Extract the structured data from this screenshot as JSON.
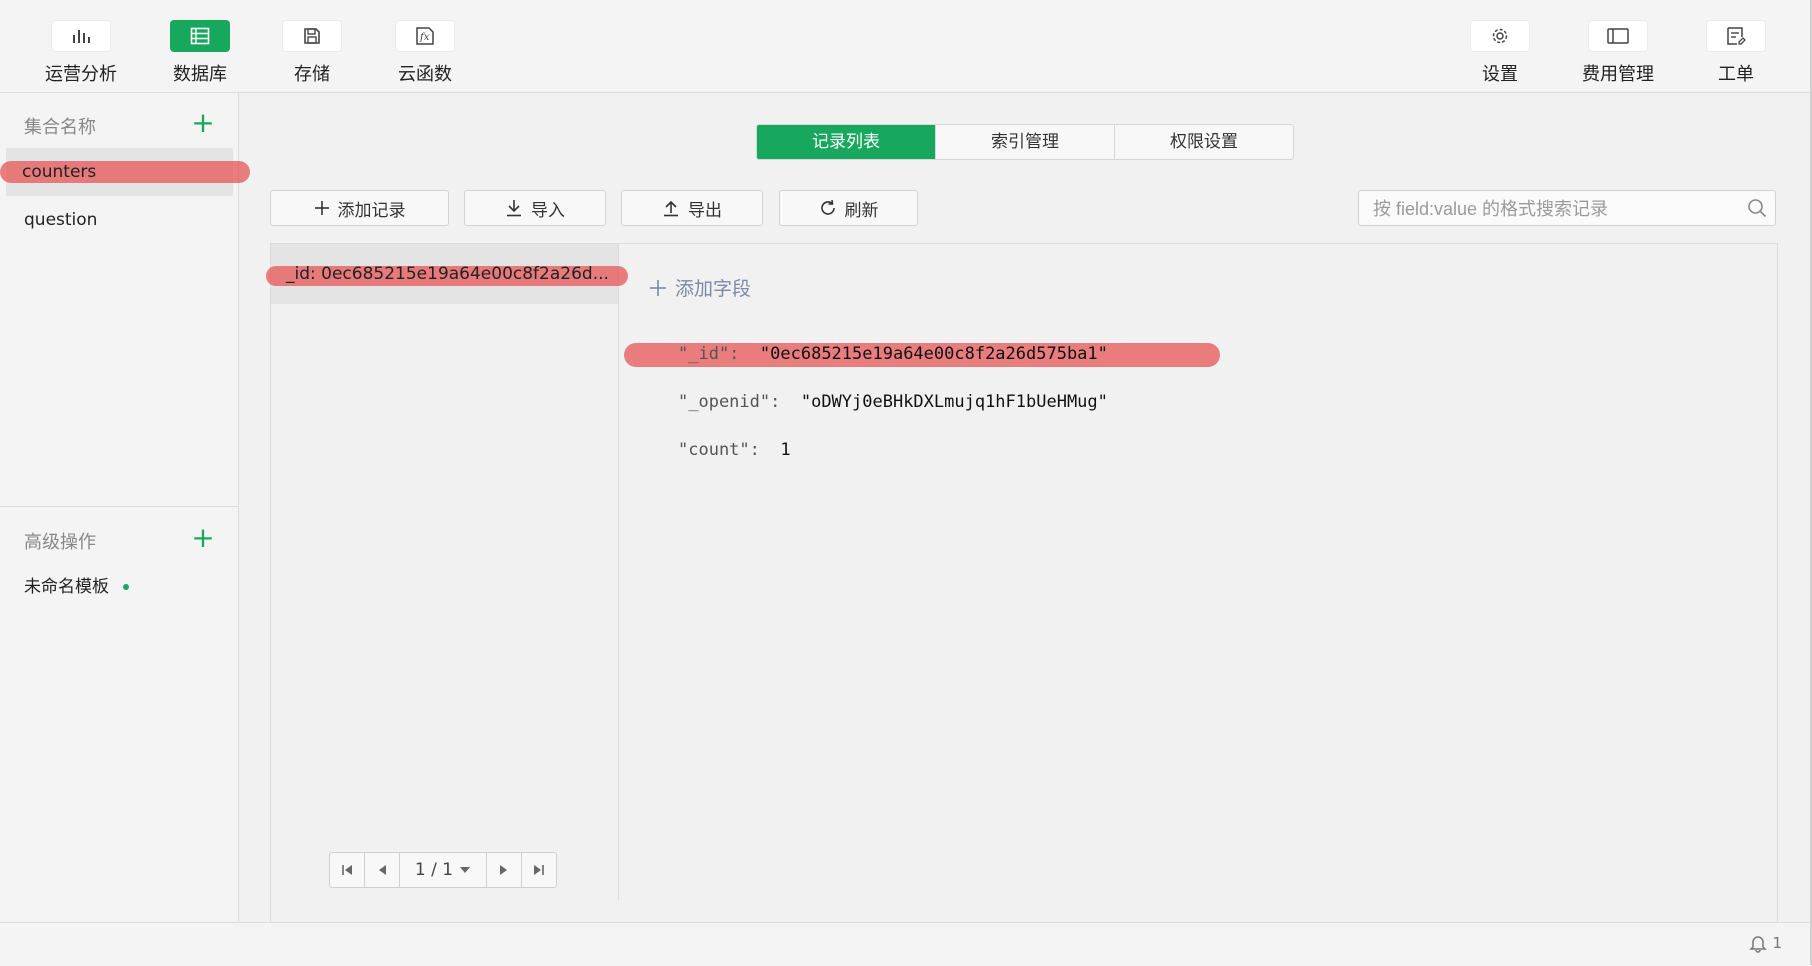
{
  "toolbar": {
    "left_items": [
      {
        "label": "运营分析",
        "icon": "bar-chart-icon"
      },
      {
        "label": "数据库",
        "icon": "database-icon",
        "active": true
      },
      {
        "label": "存储",
        "icon": "floppy-disk-icon"
      },
      {
        "label": "云函数",
        "icon": "function-fx-icon"
      }
    ],
    "right_items": [
      {
        "label": "设置",
        "icon": "gear-icon"
      },
      {
        "label": "费用管理",
        "icon": "billing-card-icon"
      },
      {
        "label": "工单",
        "icon": "ticket-icon"
      }
    ]
  },
  "sidebar": {
    "collections_header": "集合名称",
    "collections": [
      "counters",
      "question"
    ],
    "selected_collection": "counters",
    "advanced_header": "高级操作",
    "templates": [
      "未命名模板"
    ]
  },
  "tabs": [
    {
      "label": "记录列表",
      "active": true
    },
    {
      "label": "索引管理",
      "active": false
    },
    {
      "label": "权限设置",
      "active": false
    }
  ],
  "actions": {
    "add_record": "添加记录",
    "import": "导入",
    "export": "导出",
    "refresh": "刷新"
  },
  "search": {
    "placeholder": "按 field:value 的格式搜索记录"
  },
  "records": {
    "list_item": "_id: 0ec685215e19a64e00c8f2a26d575ba1",
    "list_item_display": "_id: 0ec685215e19a64e00c8f2a26d...",
    "pager_text": "1 / 1"
  },
  "detail": {
    "add_field": "添加字段",
    "fields": [
      {
        "key": "\"_id\":",
        "value": "\"0ec685215e19a64e00c8f2a26d575ba1\""
      },
      {
        "key": "\"_openid\":",
        "value": "\"oDWYj0eBHkDXLmujq1hF1bUeHMug\""
      },
      {
        "key": "\"count\":",
        "value": "1"
      }
    ]
  },
  "status": {
    "notification_count": "1"
  },
  "colors": {
    "accent": "#17a85e",
    "highlight": "#e65050"
  }
}
